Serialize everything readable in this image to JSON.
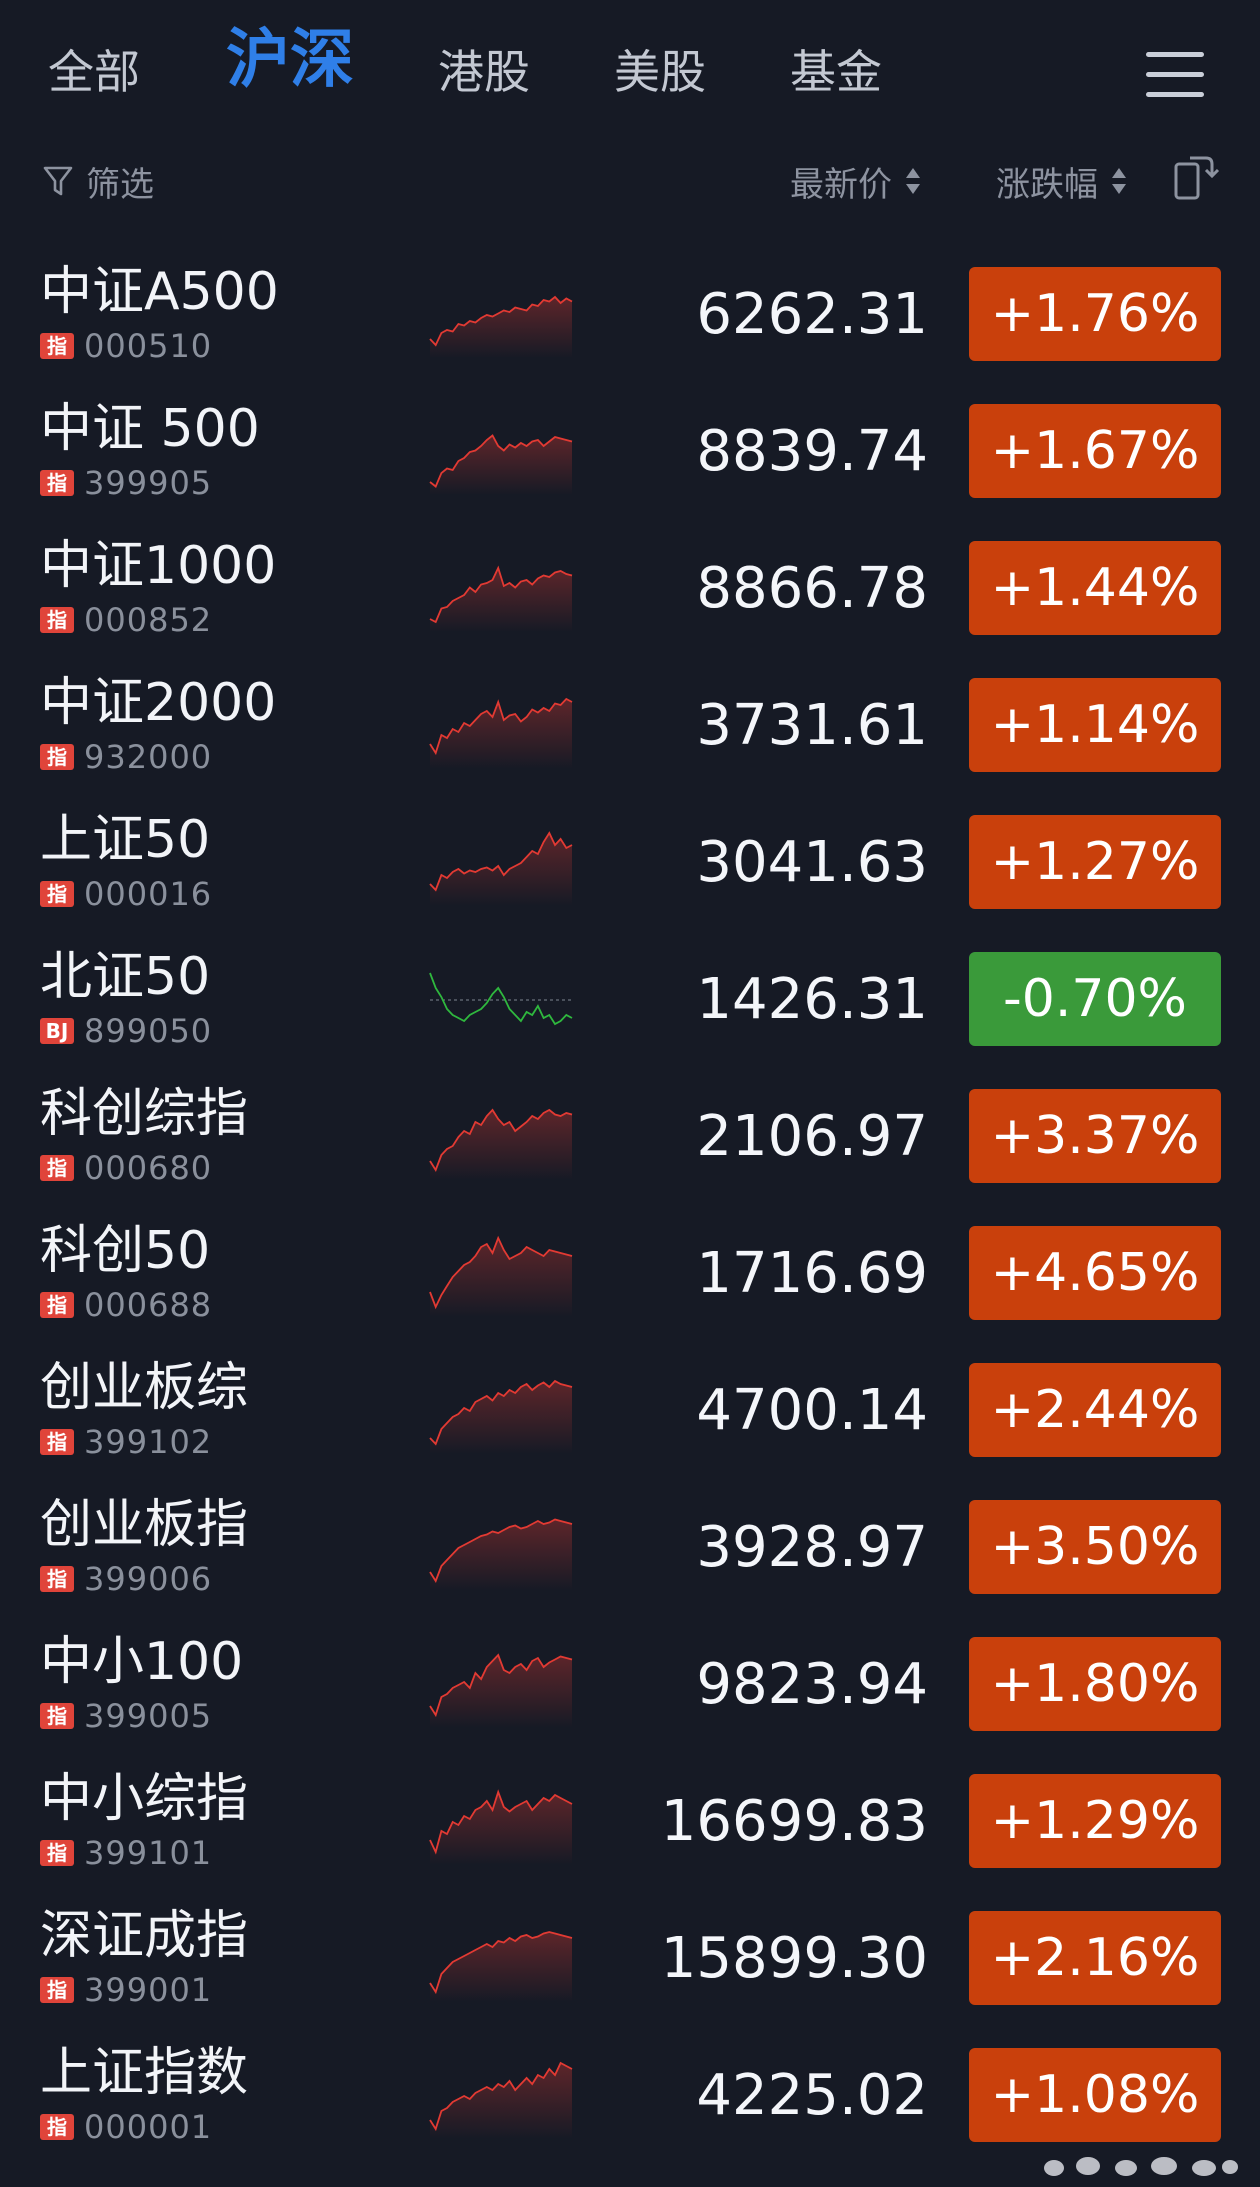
{
  "tabs": [
    {
      "label": "全部",
      "active": false
    },
    {
      "label": "沪深",
      "active": true
    },
    {
      "label": "港股",
      "active": false
    },
    {
      "label": "美股",
      "active": false
    },
    {
      "label": "基金",
      "active": false
    }
  ],
  "icons": {
    "menu": "hamburger-menu-icon",
    "filter": "funnel-icon",
    "sort": "sort-arrows-icon",
    "switch": "layout-switch-icon"
  },
  "filter": {
    "label": "筛选"
  },
  "sort_headers": {
    "price_label": "最新价",
    "change_label": "涨跌幅"
  },
  "colors": {
    "background": "#161a25",
    "active_tab": "#2f7fe8",
    "up": "#c9400c",
    "down": "#3a9a3a",
    "index_tag": "#e0443a",
    "spark_up": "#e23a33",
    "spark_down": "#2fb83e"
  },
  "rows": [
    {
      "name": "中证A500",
      "tag": "指",
      "code": "000510",
      "price": "6262.31",
      "change": "+1.76%",
      "direction": "up",
      "spark": [
        10,
        6,
        14,
        16,
        15,
        20,
        19,
        22,
        21,
        24,
        26,
        25,
        27,
        29,
        28,
        31,
        30,
        29,
        33,
        32,
        36,
        35,
        38,
        34,
        37,
        35
      ]
    },
    {
      "name": "中证 500",
      "tag": "指",
      "code": "399905",
      "price": "8839.74",
      "change": "+1.67%",
      "direction": "up",
      "spark": [
        6,
        3,
        12,
        15,
        14,
        20,
        22,
        26,
        27,
        30,
        34,
        37,
        30,
        27,
        31,
        29,
        32,
        30,
        33,
        34,
        30,
        33,
        36,
        35,
        34,
        33
      ]
    },
    {
      "name": "中证1000",
      "tag": "指",
      "code": "000852",
      "price": "8866.78",
      "change": "+1.44%",
      "direction": "up",
      "spark": [
        6,
        4,
        13,
        14,
        18,
        20,
        22,
        27,
        24,
        29,
        30,
        32,
        40,
        28,
        30,
        27,
        31,
        32,
        29,
        33,
        35,
        34,
        37,
        38,
        36,
        35
      ]
    },
    {
      "name": "中证2000",
      "tag": "指",
      "code": "932000",
      "price": "3731.61",
      "change": "+1.14%",
      "direction": "up",
      "spark": [
        14,
        8,
        20,
        18,
        24,
        22,
        28,
        26,
        30,
        34,
        36,
        32,
        42,
        30,
        33,
        34,
        29,
        32,
        37,
        35,
        38,
        36,
        41,
        40,
        44,
        42
      ]
    },
    {
      "name": "上证50",
      "tag": "指",
      "code": "000016",
      "price": "3041.63",
      "change": "+1.27%",
      "direction": "up",
      "spark": [
        12,
        8,
        18,
        16,
        20,
        22,
        19,
        21,
        20,
        22,
        23,
        21,
        24,
        18,
        22,
        24,
        26,
        30,
        34,
        32,
        40,
        46,
        38,
        42,
        36,
        38
      ]
    },
    {
      "name": "北证50",
      "tag": "BJ",
      "code": "899050",
      "price": "1426.31",
      "change": "-0.70%",
      "direction": "down",
      "baseline": 26,
      "spark": [
        44,
        34,
        28,
        20,
        16,
        14,
        12,
        16,
        18,
        20,
        24,
        30,
        34,
        28,
        20,
        16,
        12,
        18,
        16,
        22,
        14,
        16,
        10,
        12,
        16,
        14
      ]
    },
    {
      "name": "科创综指",
      "tag": "指",
      "code": "000680",
      "price": "2106.97",
      "change": "+3.37%",
      "direction": "up",
      "spark": [
        10,
        4,
        14,
        18,
        20,
        26,
        30,
        28,
        36,
        34,
        40,
        44,
        38,
        34,
        36,
        30,
        33,
        36,
        40,
        38,
        42,
        44,
        41,
        40,
        42,
        41
      ]
    },
    {
      "name": "科创50",
      "tag": "指",
      "code": "000688",
      "price": "1716.69",
      "change": "+4.65%",
      "direction": "up",
      "spark": [
        14,
        4,
        12,
        18,
        24,
        28,
        32,
        34,
        38,
        44,
        46,
        40,
        50,
        42,
        36,
        38,
        40,
        44,
        42,
        40,
        38,
        42,
        41,
        40,
        39,
        38
      ]
    },
    {
      "name": "创业板综",
      "tag": "指",
      "code": "399102",
      "price": "4700.14",
      "change": "+2.44%",
      "direction": "up",
      "spark": [
        8,
        4,
        14,
        18,
        22,
        24,
        28,
        26,
        32,
        34,
        36,
        33,
        38,
        36,
        40,
        38,
        42,
        44,
        40,
        43,
        45,
        42,
        46,
        44,
        43,
        42
      ]
    },
    {
      "name": "创业板指",
      "tag": "指",
      "code": "399006",
      "price": "3928.97",
      "change": "+3.50%",
      "direction": "up",
      "spark": [
        10,
        4,
        14,
        18,
        22,
        26,
        28,
        30,
        32,
        34,
        35,
        37,
        36,
        38,
        40,
        41,
        39,
        40,
        42,
        44,
        42,
        43,
        45,
        44,
        43,
        42
      ]
    },
    {
      "name": "中小100",
      "tag": "指",
      "code": "399005",
      "price": "9823.94",
      "change": "+1.80%",
      "direction": "up",
      "spark": [
        12,
        6,
        18,
        20,
        24,
        26,
        28,
        24,
        34,
        30,
        38,
        42,
        46,
        36,
        34,
        38,
        40,
        36,
        42,
        44,
        38,
        41,
        43,
        45,
        44,
        43
      ]
    },
    {
      "name": "中小综指",
      "tag": "指",
      "code": "399101",
      "price": "16699.83",
      "change": "+1.29%",
      "direction": "up",
      "spark": [
        14,
        6,
        20,
        18,
        26,
        24,
        30,
        28,
        34,
        36,
        40,
        34,
        46,
        36,
        33,
        36,
        38,
        40,
        34,
        38,
        42,
        40,
        44,
        42,
        40,
        38
      ]
    },
    {
      "name": "深证成指",
      "tag": "指",
      "code": "399001",
      "price": "15899.30",
      "change": "+2.16%",
      "direction": "up",
      "spark": [
        10,
        4,
        16,
        20,
        24,
        26,
        28,
        30,
        32,
        34,
        36,
        34,
        38,
        37,
        40,
        38,
        41,
        42,
        40,
        41,
        43,
        44,
        43,
        42,
        41,
        40
      ]
    },
    {
      "name": "上证指数",
      "tag": "指",
      "code": "000001",
      "price": "4225.02",
      "change": "+1.08%",
      "direction": "up",
      "spark": [
        10,
        4,
        16,
        18,
        22,
        24,
        26,
        24,
        28,
        30,
        32,
        30,
        34,
        32,
        36,
        30,
        34,
        38,
        34,
        40,
        38,
        44,
        40,
        48,
        46,
        44
      ]
    }
  ]
}
